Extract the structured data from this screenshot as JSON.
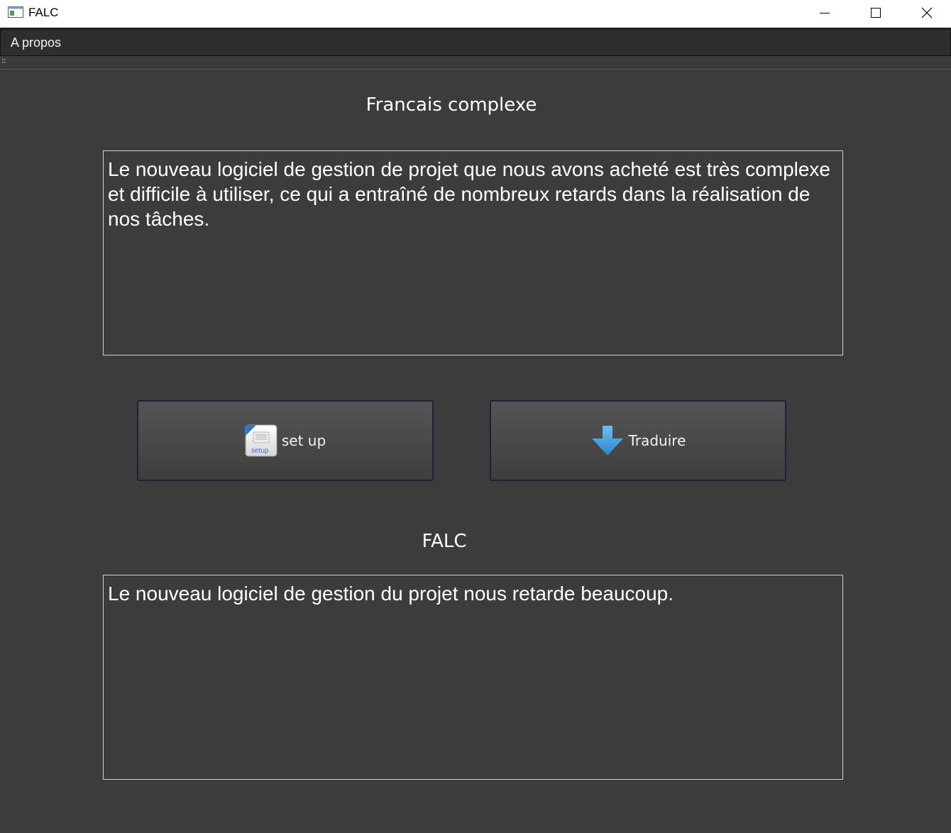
{
  "window": {
    "title": "FALC",
    "icon": "app-window-icon",
    "controls": [
      "minimize-icon",
      "maximize-icon",
      "close-icon"
    ]
  },
  "menu": {
    "items": [
      {
        "label": "A propos"
      }
    ]
  },
  "source": {
    "label": "Francais complexe",
    "text": "Le nouveau logiciel de gestion de projet que nous avons acheté est très complexe et difficile à utiliser, ce qui a entraîné de nombreux retards dans la réalisation de nos tâches."
  },
  "buttons": {
    "setup": {
      "label": "set up",
      "icon": "setup-icon",
      "icon_text": "setup"
    },
    "translate": {
      "label": "Traduire",
      "icon": "arrow-down-icon"
    }
  },
  "output": {
    "label": "FALC",
    "text": "Le nouveau logiciel de gestion du projet nous retarde beaucoup."
  },
  "colors": {
    "background": "#3c3c3c",
    "text": "#ffffff",
    "arrow": "#3a9ad9",
    "button_border": "#1a2438"
  }
}
